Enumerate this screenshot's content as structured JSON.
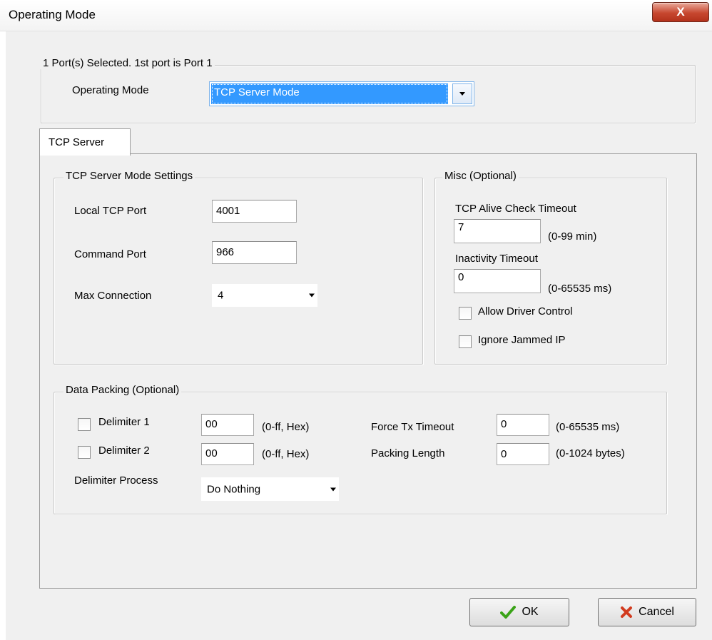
{
  "window": {
    "title": "Operating Mode",
    "close_label": "X"
  },
  "port_selection": {
    "legend": "1 Port(s) Selected. 1st port is Port 1",
    "mode_label": "Operating Mode",
    "mode_value": "TCP Server Mode"
  },
  "tabs": [
    {
      "label": "TCP Server",
      "selected": true
    }
  ],
  "tcp_server_settings": {
    "legend": "TCP Server Mode Settings",
    "local_tcp_port_label": "Local TCP Port",
    "local_tcp_port_value": "4001",
    "command_port_label": "Command Port",
    "command_port_value": "966",
    "max_connection_label": "Max Connection",
    "max_connection_value": "4"
  },
  "misc": {
    "legend": "Misc (Optional)",
    "alive_check_label": "TCP Alive Check Timeout",
    "alive_check_value": "7",
    "alive_check_range": "(0-99 min)",
    "inactivity_label": "Inactivity Timeout",
    "inactivity_value": "0",
    "inactivity_range": "(0-65535 ms)",
    "allow_driver_control_label": "Allow Driver Control",
    "allow_driver_control_checked": false,
    "ignore_jammed_ip_label": "Ignore Jammed IP",
    "ignore_jammed_ip_checked": false
  },
  "data_packing": {
    "legend": "Data Packing (Optional)",
    "delimiter1_label": "Delimiter 1",
    "delimiter1_value": "00",
    "delimiter1_range": "(0-ff, Hex)",
    "delimiter1_checked": false,
    "delimiter2_label": "Delimiter 2",
    "delimiter2_value": "00",
    "delimiter2_range": "(0-ff, Hex)",
    "delimiter2_checked": false,
    "delimiter_process_label": "Delimiter Process",
    "delimiter_process_value": "Do Nothing",
    "force_tx_label": "Force Tx Timeout",
    "force_tx_value": "0",
    "force_tx_range": "(0-65535 ms)",
    "packing_length_label": "Packing Length",
    "packing_length_value": "0",
    "packing_length_range": "(0-1024 bytes)"
  },
  "buttons": {
    "ok_label": "OK",
    "cancel_label": "Cancel"
  },
  "colors": {
    "selection_bg": "#3399ff",
    "ok_check": "#3aa317",
    "cancel_x": "#d23b1e",
    "close_button": "#c7472f"
  }
}
